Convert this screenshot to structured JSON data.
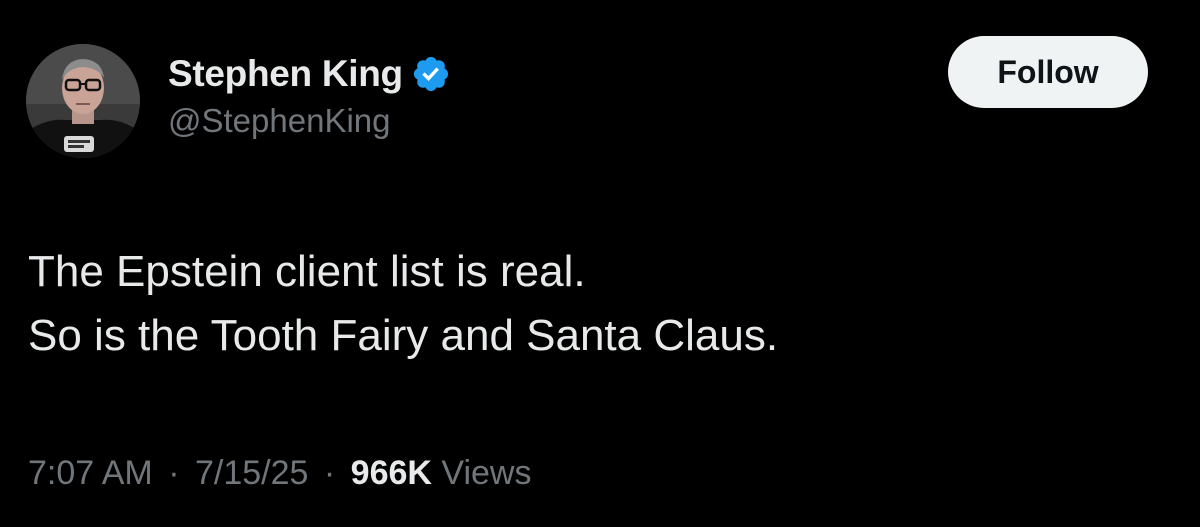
{
  "author": {
    "display_name": "Stephen King",
    "handle": "@StephenKing",
    "verified": true,
    "avatar_icon": "profile-photo"
  },
  "follow_button": {
    "label": "Follow"
  },
  "tweet": {
    "lines": [
      "The Epstein client list is real.",
      "So is the Tooth Fairy and Santa Claus."
    ]
  },
  "meta": {
    "time": "7:07 AM",
    "separator": "·",
    "date": "7/15/25",
    "views_count": "966K",
    "views_label": "Views"
  },
  "colors": {
    "background": "#000000",
    "primary_text": "#e7e9ea",
    "secondary_text": "#71767b",
    "verified_badge": "#1d9bf0",
    "follow_button_bg": "#eff3f4"
  }
}
